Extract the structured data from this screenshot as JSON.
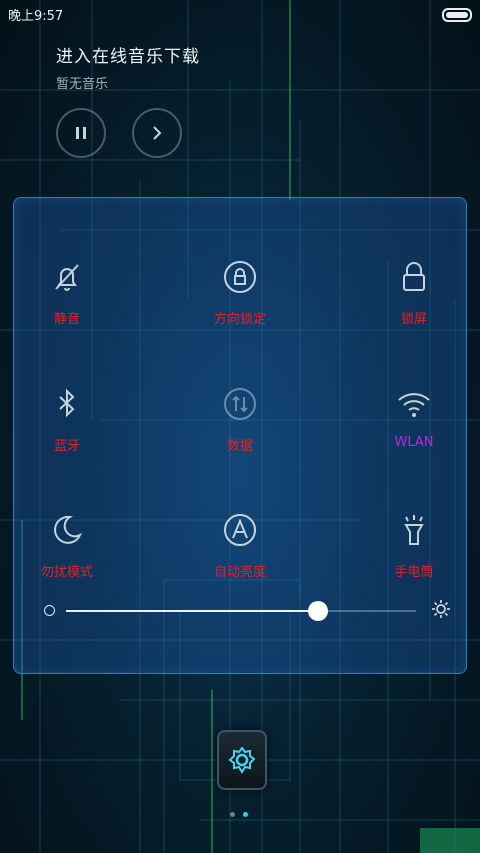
{
  "status_bar": {
    "time": "晚上9:57"
  },
  "music": {
    "title": "进入在线音乐下载",
    "subtitle": "暂无音乐"
  },
  "panel": {
    "tiles": [
      {
        "label": "静音",
        "icon": "bell-off-icon"
      },
      {
        "label": "方向锁定",
        "icon": "rotation-lock-icon"
      },
      {
        "label": "锁屏",
        "icon": "lock-icon"
      },
      {
        "label": "蓝牙",
        "icon": "bluetooth-icon"
      },
      {
        "label": "数据",
        "icon": "mobile-data-icon"
      },
      {
        "label": "WLAN",
        "icon": "wifi-icon"
      },
      {
        "label": "勿扰模式",
        "icon": "moon-icon"
      },
      {
        "label": "自动亮度",
        "icon": "auto-brightness-icon"
      },
      {
        "label": "手电筒",
        "icon": "flashlight-icon"
      }
    ],
    "brightness": {
      "level": 0.72
    }
  },
  "colors": {
    "label_red": "#e4202a",
    "label_purple": "#b52be0",
    "page_dot_active": "#2fd1e6"
  },
  "pager": {
    "pages": 2,
    "active": 1
  }
}
